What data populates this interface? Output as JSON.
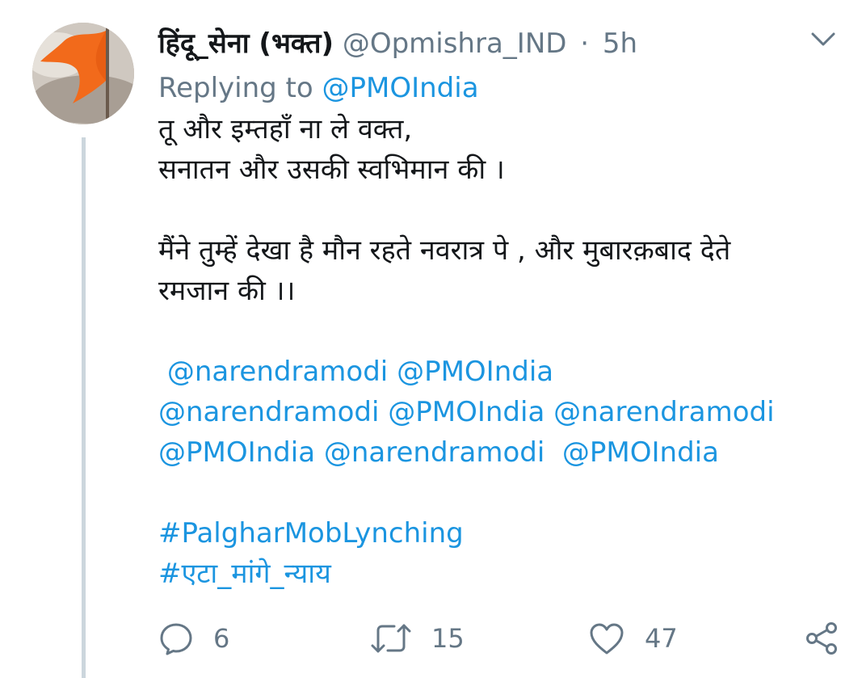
{
  "tweet": {
    "display_name": "हिंदू_सेना (भक्त)",
    "handle": "@Opmishra_IND",
    "separator": "·",
    "time": "5h",
    "replying_prefix": "Replying to",
    "replying_to": "@PMOIndia",
    "lines": {
      "l1": "तू और इम्तहाँ ना ले वक्त,",
      "l2": " सनातन और उसकी स्वभिमान की ।",
      "l3": "मैंने तुम्हें देखा है मौन रहते नवरात्र पे , और  मुबारक़बाद देते",
      "l4": "रमजान की ।।"
    },
    "mentions": {
      "row1_a": "@narendramodi",
      "row1_b": "@PMOIndia",
      "row2_a": "@narendramodi",
      "row2_b": "@PMOIndia",
      "row2_c": "@narendramodi",
      "row3_a": "@PMOIndia",
      "row3_b": "@narendramodi",
      "row3_c": "@PMOIndia"
    },
    "hashtags": {
      "h1": "#PalgharMobLynching",
      "h2": "#एटा_मांगे_न्याय"
    },
    "actions": {
      "reply_count": "6",
      "retweet_count": "15",
      "like_count": "47"
    }
  },
  "icons": {
    "reply": "reply-icon",
    "retweet": "retweet-icon",
    "like": "heart-icon",
    "share": "share-icon",
    "menu": "chevron-down-icon"
  },
  "colors": {
    "link": "#1b95e0",
    "muted": "#657786",
    "text": "#14171a",
    "thread_line": "#ccd6dd",
    "flag": "#f26a1b"
  }
}
